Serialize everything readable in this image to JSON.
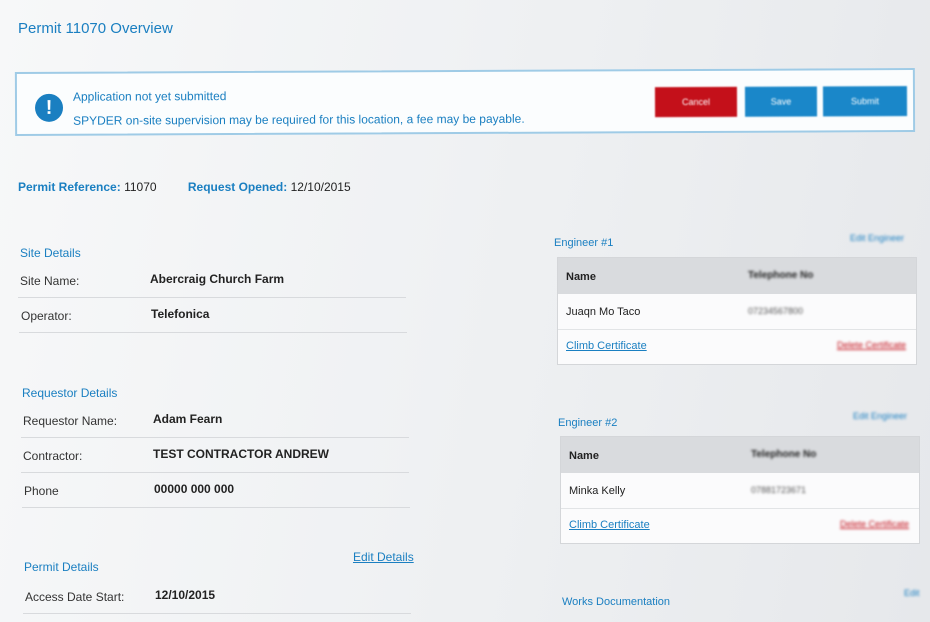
{
  "page": {
    "title": "Permit 11070 Overview"
  },
  "alert": {
    "icon": "exclamation-icon",
    "title": "Application not yet submitted",
    "message": "SPYDER on-site supervision may be required for this location, a fee may be payable.",
    "buttons": {
      "cancel": "Cancel",
      "save": "Save",
      "submit": "Submit"
    },
    "colors": {
      "cancel": "#c4101a",
      "primary": "#1a87c9"
    }
  },
  "references": {
    "permit_ref_label": "Permit Reference:",
    "permit_ref_value": "11070",
    "request_opened_label": "Request Opened:",
    "request_opened_value": "12/10/2015"
  },
  "site": {
    "title": "Site Details",
    "rows": [
      {
        "label": "Site Name:",
        "value": "Abercraig Church Farm"
      },
      {
        "label": "Operator:",
        "value": "Telefonica"
      }
    ]
  },
  "requestor": {
    "title": "Requestor Details",
    "rows": [
      {
        "label": "Requestor Name:",
        "value": "Adam Fearn"
      },
      {
        "label": "Contractor:",
        "value": "TEST CONTRACTOR ANDREW"
      },
      {
        "label": "Phone",
        "value": "00000 000 000"
      }
    ]
  },
  "permit": {
    "title": "Permit Details",
    "edit_label": "Edit Details",
    "rows": [
      {
        "label": "Access Date Start:",
        "value": "12/10/2015"
      }
    ]
  },
  "engineers": [
    {
      "title": "Engineer #1",
      "edit_label": "Edit Engineer",
      "col_name": "Name",
      "col_phone": "Telephone No",
      "name": "Juaqn Mo Taco",
      "phone": "07234567800",
      "cert_link": "Climb Certificate",
      "delete_link": "Delete Certificate"
    },
    {
      "title": "Engineer #2",
      "edit_label": "Edit Engineer",
      "col_name": "Name",
      "col_phone": "Telephone No",
      "name": "Minka Kelly",
      "phone": "07881723671",
      "cert_link": "Climb Certificate",
      "delete_link": "Delete Certificate"
    }
  ],
  "works": {
    "title": "Works Documentation",
    "edit_label": "Edit"
  }
}
